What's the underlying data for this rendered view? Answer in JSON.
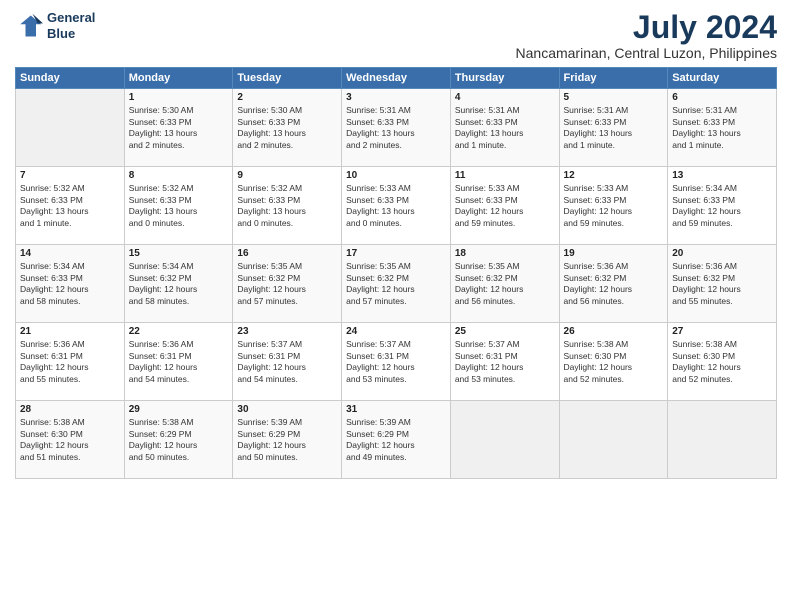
{
  "logo": {
    "line1": "General",
    "line2": "Blue"
  },
  "title": "July 2024",
  "subtitle": "Nancamarinan, Central Luzon, Philippines",
  "header_days": [
    "Sunday",
    "Monday",
    "Tuesday",
    "Wednesday",
    "Thursday",
    "Friday",
    "Saturday"
  ],
  "weeks": [
    [
      {
        "day": "",
        "lines": []
      },
      {
        "day": "1",
        "lines": [
          "Sunrise: 5:30 AM",
          "Sunset: 6:33 PM",
          "Daylight: 13 hours",
          "and 2 minutes."
        ]
      },
      {
        "day": "2",
        "lines": [
          "Sunrise: 5:30 AM",
          "Sunset: 6:33 PM",
          "Daylight: 13 hours",
          "and 2 minutes."
        ]
      },
      {
        "day": "3",
        "lines": [
          "Sunrise: 5:31 AM",
          "Sunset: 6:33 PM",
          "Daylight: 13 hours",
          "and 2 minutes."
        ]
      },
      {
        "day": "4",
        "lines": [
          "Sunrise: 5:31 AM",
          "Sunset: 6:33 PM",
          "Daylight: 13 hours",
          "and 1 minute."
        ]
      },
      {
        "day": "5",
        "lines": [
          "Sunrise: 5:31 AM",
          "Sunset: 6:33 PM",
          "Daylight: 13 hours",
          "and 1 minute."
        ]
      },
      {
        "day": "6",
        "lines": [
          "Sunrise: 5:31 AM",
          "Sunset: 6:33 PM",
          "Daylight: 13 hours",
          "and 1 minute."
        ]
      }
    ],
    [
      {
        "day": "7",
        "lines": [
          "Sunrise: 5:32 AM",
          "Sunset: 6:33 PM",
          "Daylight: 13 hours",
          "and 1 minute."
        ]
      },
      {
        "day": "8",
        "lines": [
          "Sunrise: 5:32 AM",
          "Sunset: 6:33 PM",
          "Daylight: 13 hours",
          "and 0 minutes."
        ]
      },
      {
        "day": "9",
        "lines": [
          "Sunrise: 5:32 AM",
          "Sunset: 6:33 PM",
          "Daylight: 13 hours",
          "and 0 minutes."
        ]
      },
      {
        "day": "10",
        "lines": [
          "Sunrise: 5:33 AM",
          "Sunset: 6:33 PM",
          "Daylight: 13 hours",
          "and 0 minutes."
        ]
      },
      {
        "day": "11",
        "lines": [
          "Sunrise: 5:33 AM",
          "Sunset: 6:33 PM",
          "Daylight: 12 hours",
          "and 59 minutes."
        ]
      },
      {
        "day": "12",
        "lines": [
          "Sunrise: 5:33 AM",
          "Sunset: 6:33 PM",
          "Daylight: 12 hours",
          "and 59 minutes."
        ]
      },
      {
        "day": "13",
        "lines": [
          "Sunrise: 5:34 AM",
          "Sunset: 6:33 PM",
          "Daylight: 12 hours",
          "and 59 minutes."
        ]
      }
    ],
    [
      {
        "day": "14",
        "lines": [
          "Sunrise: 5:34 AM",
          "Sunset: 6:33 PM",
          "Daylight: 12 hours",
          "and 58 minutes."
        ]
      },
      {
        "day": "15",
        "lines": [
          "Sunrise: 5:34 AM",
          "Sunset: 6:32 PM",
          "Daylight: 12 hours",
          "and 58 minutes."
        ]
      },
      {
        "day": "16",
        "lines": [
          "Sunrise: 5:35 AM",
          "Sunset: 6:32 PM",
          "Daylight: 12 hours",
          "and 57 minutes."
        ]
      },
      {
        "day": "17",
        "lines": [
          "Sunrise: 5:35 AM",
          "Sunset: 6:32 PM",
          "Daylight: 12 hours",
          "and 57 minutes."
        ]
      },
      {
        "day": "18",
        "lines": [
          "Sunrise: 5:35 AM",
          "Sunset: 6:32 PM",
          "Daylight: 12 hours",
          "and 56 minutes."
        ]
      },
      {
        "day": "19",
        "lines": [
          "Sunrise: 5:36 AM",
          "Sunset: 6:32 PM",
          "Daylight: 12 hours",
          "and 56 minutes."
        ]
      },
      {
        "day": "20",
        "lines": [
          "Sunrise: 5:36 AM",
          "Sunset: 6:32 PM",
          "Daylight: 12 hours",
          "and 55 minutes."
        ]
      }
    ],
    [
      {
        "day": "21",
        "lines": [
          "Sunrise: 5:36 AM",
          "Sunset: 6:31 PM",
          "Daylight: 12 hours",
          "and 55 minutes."
        ]
      },
      {
        "day": "22",
        "lines": [
          "Sunrise: 5:36 AM",
          "Sunset: 6:31 PM",
          "Daylight: 12 hours",
          "and 54 minutes."
        ]
      },
      {
        "day": "23",
        "lines": [
          "Sunrise: 5:37 AM",
          "Sunset: 6:31 PM",
          "Daylight: 12 hours",
          "and 54 minutes."
        ]
      },
      {
        "day": "24",
        "lines": [
          "Sunrise: 5:37 AM",
          "Sunset: 6:31 PM",
          "Daylight: 12 hours",
          "and 53 minutes."
        ]
      },
      {
        "day": "25",
        "lines": [
          "Sunrise: 5:37 AM",
          "Sunset: 6:31 PM",
          "Daylight: 12 hours",
          "and 53 minutes."
        ]
      },
      {
        "day": "26",
        "lines": [
          "Sunrise: 5:38 AM",
          "Sunset: 6:30 PM",
          "Daylight: 12 hours",
          "and 52 minutes."
        ]
      },
      {
        "day": "27",
        "lines": [
          "Sunrise: 5:38 AM",
          "Sunset: 6:30 PM",
          "Daylight: 12 hours",
          "and 52 minutes."
        ]
      }
    ],
    [
      {
        "day": "28",
        "lines": [
          "Sunrise: 5:38 AM",
          "Sunset: 6:30 PM",
          "Daylight: 12 hours",
          "and 51 minutes."
        ]
      },
      {
        "day": "29",
        "lines": [
          "Sunrise: 5:38 AM",
          "Sunset: 6:29 PM",
          "Daylight: 12 hours",
          "and 50 minutes."
        ]
      },
      {
        "day": "30",
        "lines": [
          "Sunrise: 5:39 AM",
          "Sunset: 6:29 PM",
          "Daylight: 12 hours",
          "and 50 minutes."
        ]
      },
      {
        "day": "31",
        "lines": [
          "Sunrise: 5:39 AM",
          "Sunset: 6:29 PM",
          "Daylight: 12 hours",
          "and 49 minutes."
        ]
      },
      {
        "day": "",
        "lines": []
      },
      {
        "day": "",
        "lines": []
      },
      {
        "day": "",
        "lines": []
      }
    ]
  ]
}
